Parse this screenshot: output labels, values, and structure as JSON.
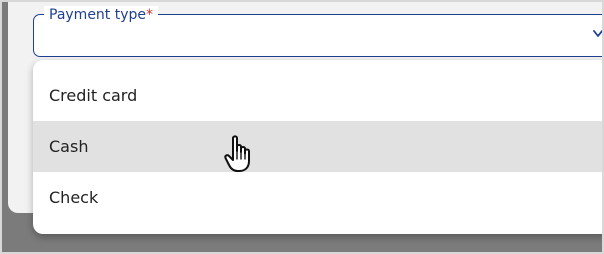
{
  "field": {
    "label": "Payment type",
    "required_mark": "*",
    "value": ""
  },
  "dropdown": {
    "options": [
      {
        "label": "Credit card"
      },
      {
        "label": "Cash",
        "hovered": true
      },
      {
        "label": "Check"
      }
    ]
  },
  "icons": {
    "field_chevron": "chevron-down-icon",
    "pointer": "hand-pointer-icon"
  },
  "colors": {
    "field_border": "#1f3f8f",
    "required": "#d32f2f",
    "hover_bg": "#e1e1e1",
    "backdrop": "#7b7b7b"
  }
}
